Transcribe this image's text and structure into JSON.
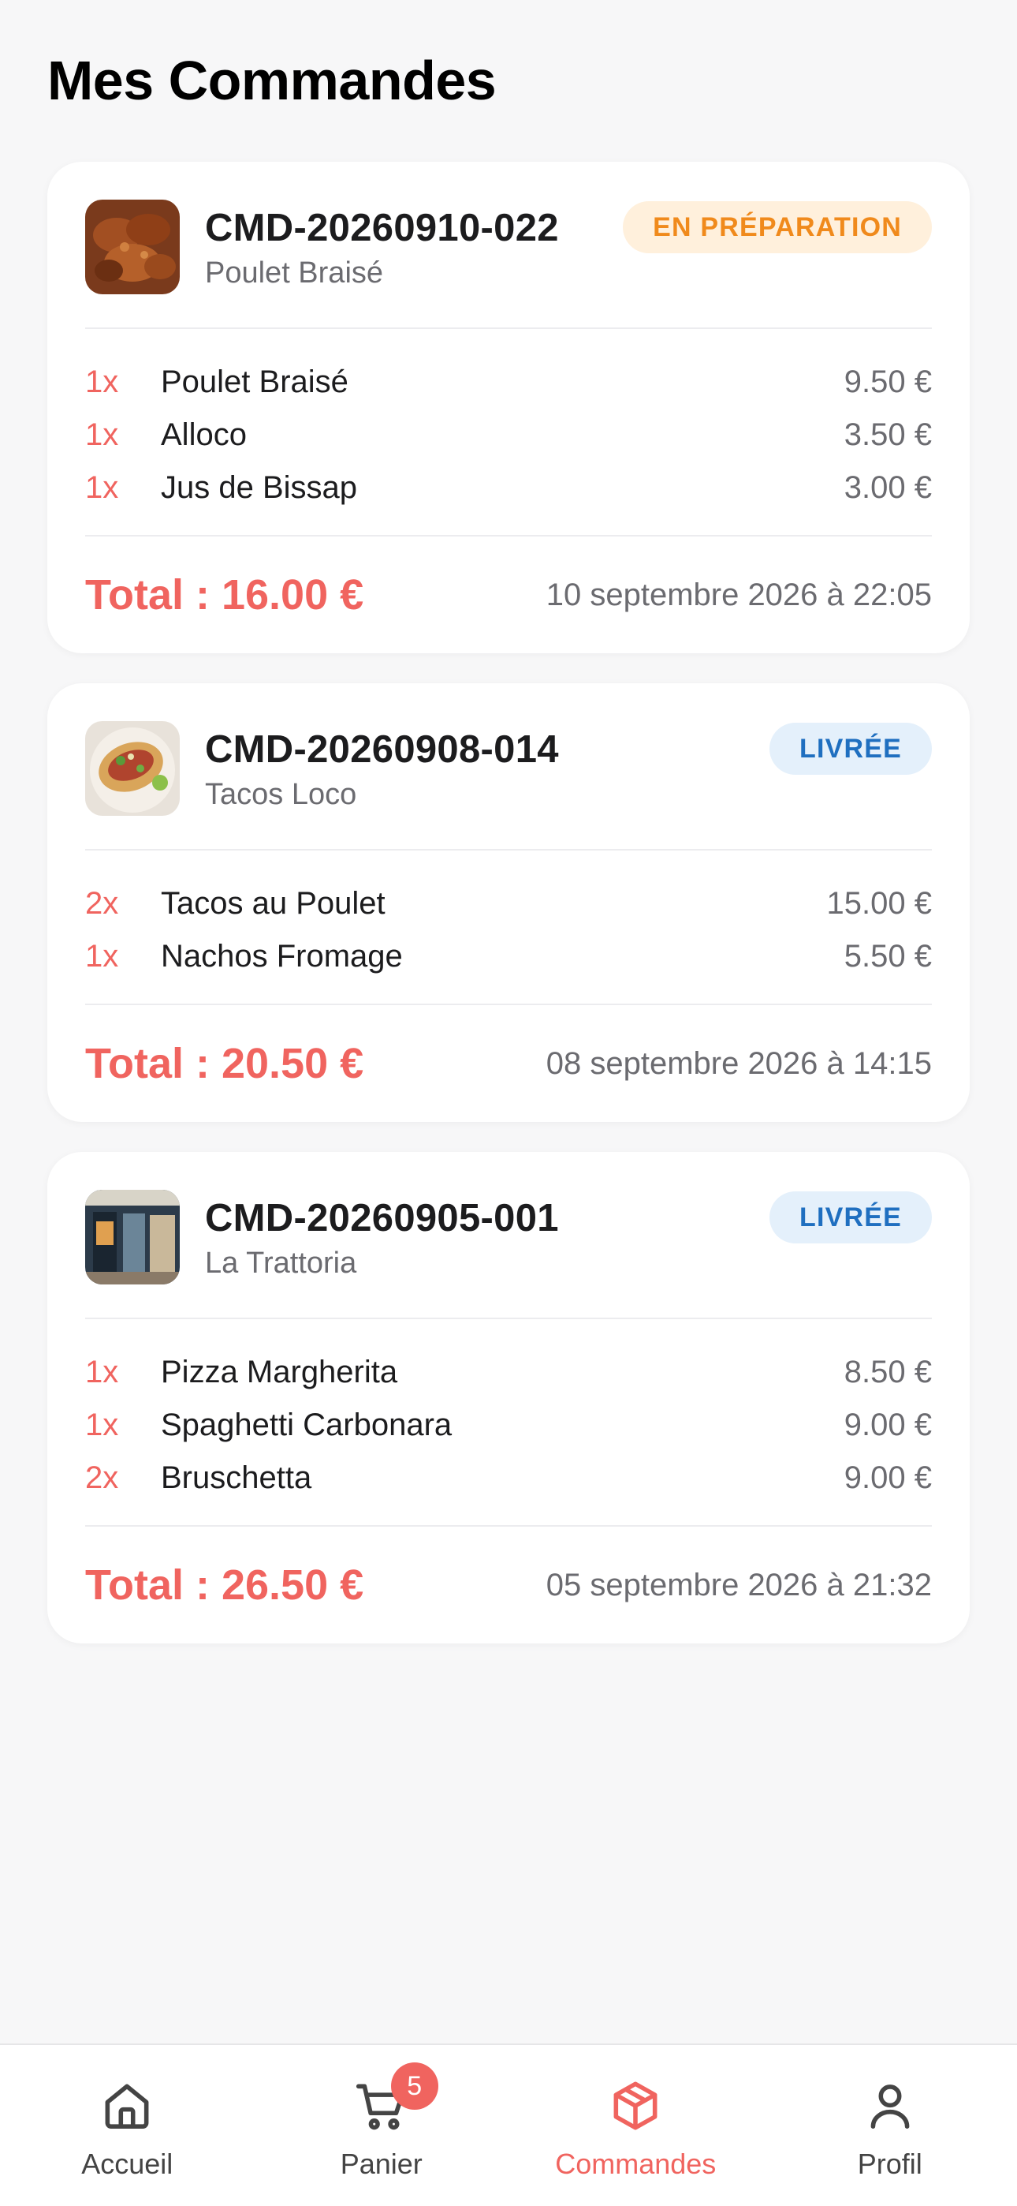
{
  "header": {
    "title": "Mes Commandes"
  },
  "orders": [
    {
      "id": "CMD-20260910-022",
      "restaurant": "Poulet Braisé",
      "status": "EN PRÉPARATION",
      "items": [
        {
          "qty": "1x",
          "name": "Poulet Braisé",
          "price": "9.50 €"
        },
        {
          "qty": "1x",
          "name": "Alloco",
          "price": "3.50 €"
        },
        {
          "qty": "1x",
          "name": "Jus de Bissap",
          "price": "3.00 €"
        }
      ],
      "total": "Total : 16.00 €",
      "date": "10 septembre 2026 à 22:05"
    },
    {
      "id": "CMD-20260908-014",
      "restaurant": "Tacos Loco",
      "status": "LIVRÉE",
      "items": [
        {
          "qty": "2x",
          "name": "Tacos au Poulet",
          "price": "15.00 €"
        },
        {
          "qty": "1x",
          "name": "Nachos Fromage",
          "price": "5.50 €"
        }
      ],
      "total": "Total : 20.50 €",
      "date": "08 septembre 2026 à 14:15"
    },
    {
      "id": "CMD-20260905-001",
      "restaurant": "La Trattoria",
      "status": "LIVRÉE",
      "items": [
        {
          "qty": "1x",
          "name": "Pizza Margherita",
          "price": "8.50 €"
        },
        {
          "qty": "1x",
          "name": "Spaghetti Carbonara",
          "price": "9.00 €"
        },
        {
          "qty": "2x",
          "name": "Bruschetta",
          "price": "9.00 €"
        }
      ],
      "total": "Total : 26.50 €",
      "date": "05 septembre 2026 à 21:32"
    }
  ],
  "tabbar": {
    "tabs": [
      {
        "label": "Accueil",
        "icon": "home-icon"
      },
      {
        "label": "Panier",
        "icon": "cart-icon",
        "badge": "5"
      },
      {
        "label": "Commandes",
        "icon": "package-icon",
        "active": true
      },
      {
        "label": "Profil",
        "icon": "user-icon"
      }
    ]
  },
  "colors": {
    "accent": "#f0645f",
    "status_prep_bg": "#fff0dc",
    "status_prep_text": "#f08a1c",
    "status_done_bg": "#e4f0fb",
    "status_done_text": "#1f6fc0"
  }
}
